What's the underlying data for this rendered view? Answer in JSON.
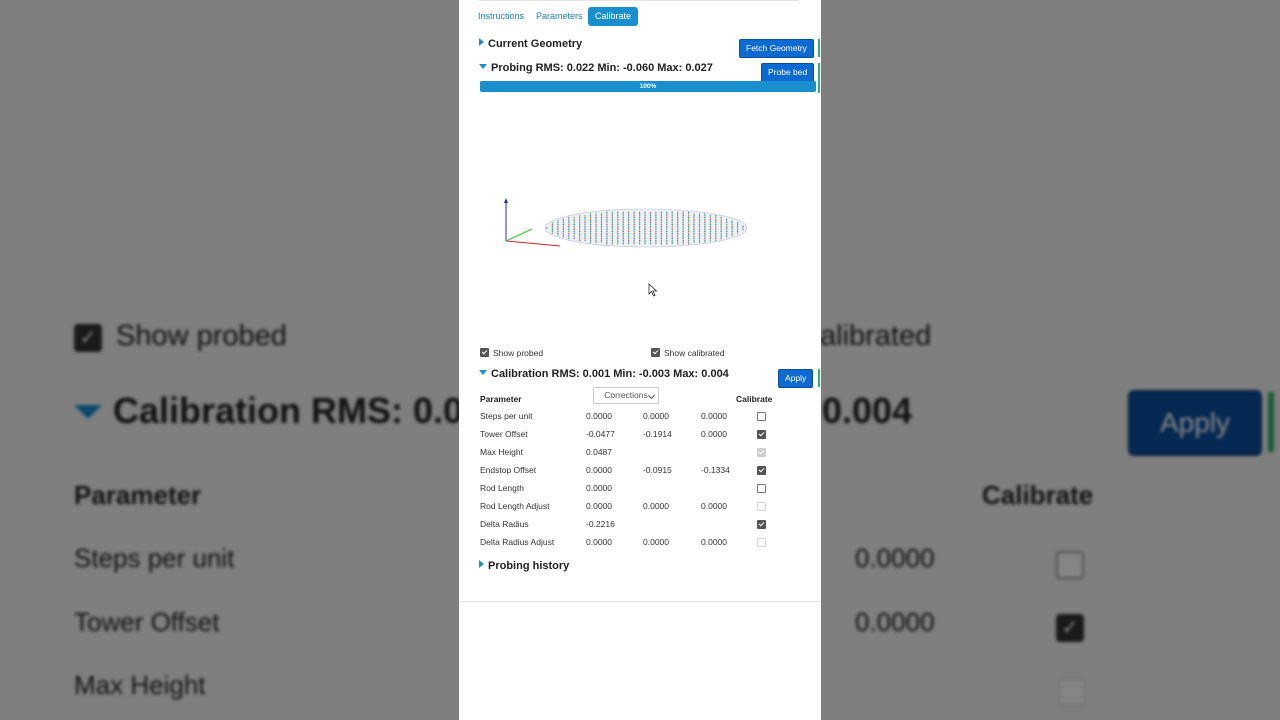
{
  "background": {
    "show_probed": "Show probed",
    "show_calibrated_partial": "alibrated",
    "calibration_rms_partial": "Calibration RMS: 0.0",
    "max_partial": "0.004",
    "apply": "Apply",
    "parameter": "Parameter",
    "calibrate": "Calibrate",
    "rows": [
      "Steps per unit",
      "Tower Offset",
      "Max Height"
    ],
    "row_values": [
      "0.0000",
      "0.0000"
    ]
  },
  "tabs": [
    "Instructions",
    "Parameters",
    "Calibrate"
  ],
  "active_tab": "Calibrate",
  "current_geometry": {
    "title": "Current Geometry",
    "fetch_button": "Fetch Geometry"
  },
  "probing": {
    "title": "Probing RMS: 0.022 Min: -0.060 Max: 0.027",
    "probe_button": "Probe bed",
    "progress": 100,
    "progress_label": "100%"
  },
  "checkboxes": {
    "show_probed": {
      "label": "Show probed",
      "checked": true
    },
    "show_calibrated": {
      "label": "Show calibrated",
      "checked": true
    }
  },
  "calibration": {
    "title": "Calibration RMS: 0.001 Min: -0.003 Max: 0.004",
    "apply_button": "Apply",
    "column_parameter": "Parameter",
    "column_calibrate": "Calibrate",
    "select_value": "Corrections",
    "rows": [
      {
        "name": "Steps per unit",
        "v1": "0.0000",
        "v2": "0.0000",
        "v3": "0.0000",
        "calibrate": false,
        "enabled": true
      },
      {
        "name": "Tower Offset",
        "v1": "-0.0477",
        "v2": "-0.1914",
        "v3": "0.0000",
        "calibrate": true,
        "enabled": true
      },
      {
        "name": "Max Height",
        "v1": "0.0487",
        "v2": "",
        "v3": "",
        "calibrate": true,
        "enabled": false
      },
      {
        "name": "Endstop Offset",
        "v1": "0.0000",
        "v2": "-0.0915",
        "v3": "-0.1334",
        "calibrate": true,
        "enabled": true
      },
      {
        "name": "Rod Length",
        "v1": "0.0000",
        "v2": "",
        "v3": "",
        "calibrate": false,
        "enabled": true
      },
      {
        "name": "Rod Length Adjust",
        "v1": "0.0000",
        "v2": "0.0000",
        "v3": "0.0000",
        "calibrate": false,
        "enabled": false
      },
      {
        "name": "Delta Radius",
        "v1": "-0.2216",
        "v2": "",
        "v3": "",
        "calibrate": true,
        "enabled": true
      },
      {
        "name": "Delta Radius Adjust",
        "v1": "0.0000",
        "v2": "0.0000",
        "v3": "0.0000",
        "calibrate": false,
        "enabled": false
      }
    ]
  },
  "probing_history": {
    "title": "Probing history"
  },
  "colors": {
    "accent": "#1a8fce",
    "button": "#0d6ad1",
    "button_edge": "#2fb36b"
  }
}
